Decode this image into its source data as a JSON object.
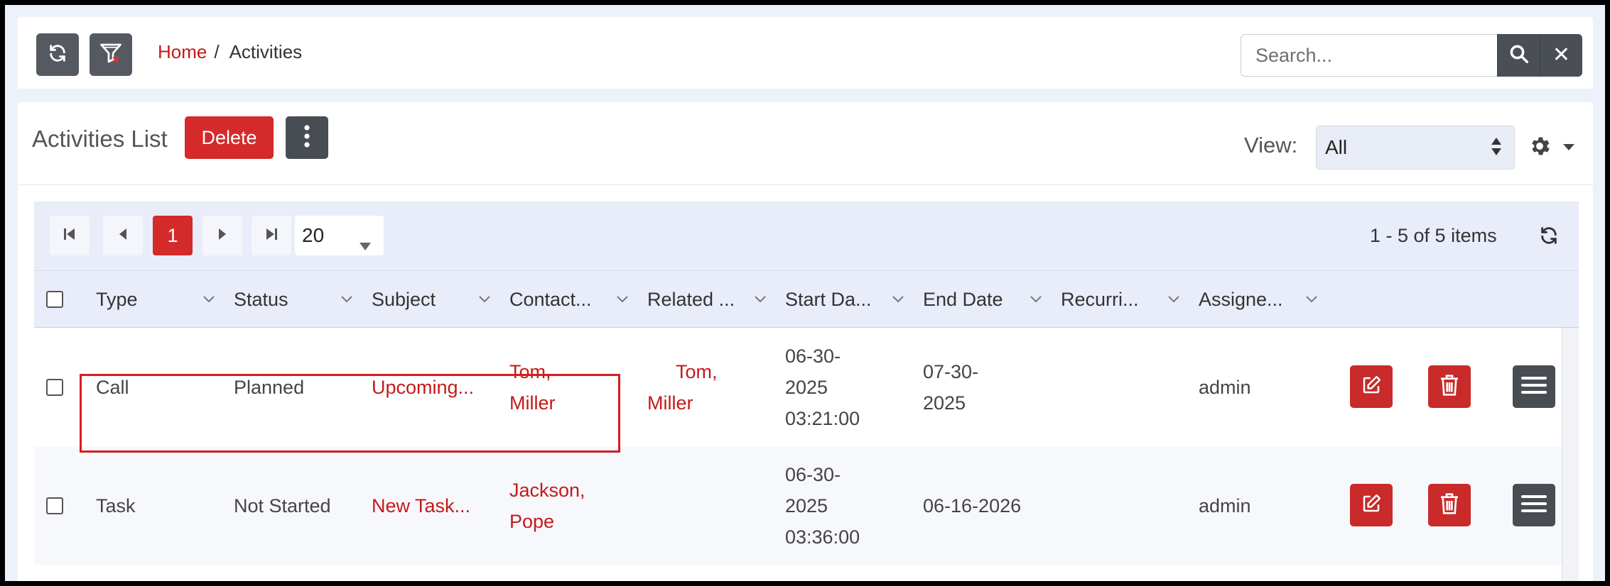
{
  "topbar": {
    "refresh_icon": "refresh-icon",
    "filter_icon": "filter-clear-icon",
    "breadcrumb": {
      "home": "Home",
      "separator": "/",
      "current": "Activities"
    },
    "search": {
      "placeholder": "Search...",
      "value": ""
    },
    "search_icon": "search-icon",
    "clear_symbol": "✕"
  },
  "header": {
    "title": "Activities List",
    "delete_label": "Delete",
    "more_icon": "vertical-dots-icon",
    "view_label": "View:",
    "view_value": "All",
    "settings_icon": "gear-icon"
  },
  "pager": {
    "current_page": "1",
    "page_size": "20",
    "items_info": "1 - 5 of 5 items"
  },
  "columns": [
    "Type",
    "Status",
    "Subject",
    "Contact...",
    "Related ...",
    "Start Da...",
    "End Date",
    "Recurri...",
    "Assigne..."
  ],
  "rows": [
    {
      "type": "Call",
      "status": "Planned",
      "subject": "Upcoming...",
      "contact": [
        "Tom,",
        "Miller"
      ],
      "related": [
        "Tom,",
        "Miller"
      ],
      "start": [
        "06-30-",
        "2025",
        "03:21:00"
      ],
      "end": [
        "07-30-",
        "2025"
      ],
      "recurring": "",
      "assigned": "admin"
    },
    {
      "type": "Task",
      "status": "Not Started",
      "subject": "New Task...",
      "contact": [
        "Jackson,",
        "Pope"
      ],
      "related": [
        "",
        ""
      ],
      "start": [
        "06-30-",
        "2025",
        "03:36:00"
      ],
      "end": [
        "06-16-2026",
        ""
      ],
      "recurring": "",
      "assigned": "admin"
    }
  ],
  "colors": {
    "accent_red": "#d42a2a",
    "link_red": "#c41a1a",
    "dark_button": "#484d53",
    "grid_header_bg": "#e9edf9",
    "highlight_border": "#d41e1e"
  }
}
